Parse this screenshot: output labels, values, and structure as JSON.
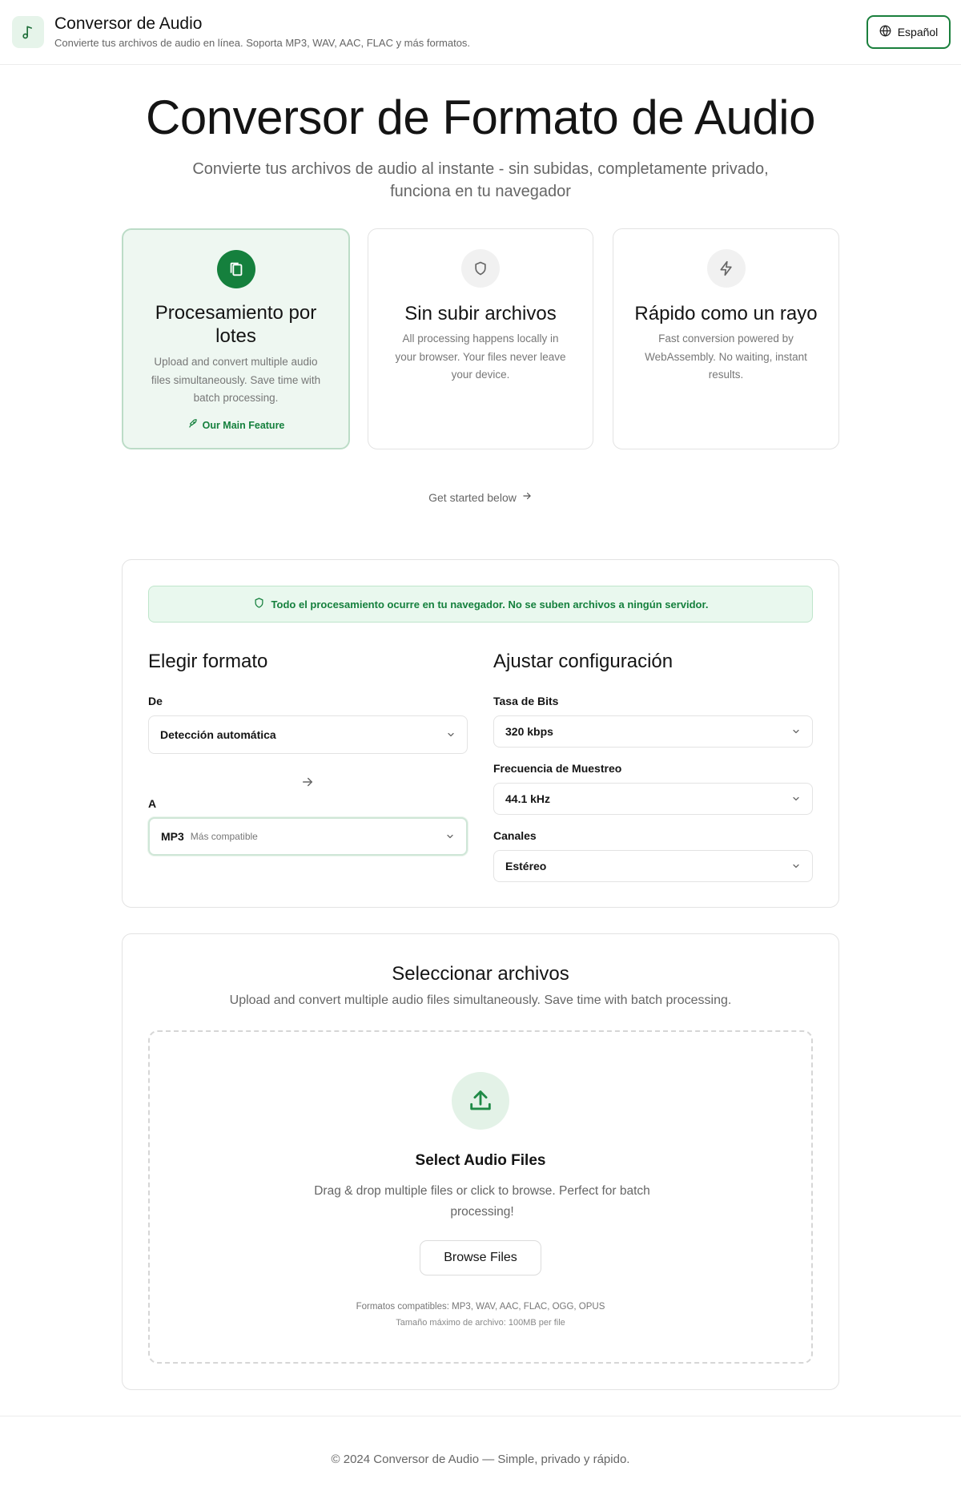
{
  "header": {
    "title": "Conversor de Audio",
    "subtitle": "Convierte tus archivos de audio en línea. Soporta MP3, WAV, AAC, FLAC y más formatos.",
    "language_button": "Español",
    "logo_icon": "music-note-icon",
    "language_icon": "globe-icon"
  },
  "hero": {
    "title": "Conversor de Formato de Audio",
    "subtitle": "Convierte tus archivos de audio al instante - sin subidas, completamente privado, funciona en tu navegador"
  },
  "features": [
    {
      "icon": "files-icon",
      "title": "Procesamiento por lotes",
      "description": "Upload and convert multiple audio files simultaneously. Save time with batch processing.",
      "tag": "Our Main Feature",
      "tag_icon": "rocket-icon",
      "highlighted": true
    },
    {
      "icon": "shield-icon",
      "title": "Sin subir archivos",
      "description": "All processing happens locally in your browser. Your files never leave your device."
    },
    {
      "icon": "lightning-icon",
      "title": "Rápido como un rayo",
      "description": "Fast conversion powered by WebAssembly. No waiting, instant results."
    }
  ],
  "get_started": "Get started below",
  "converter": {
    "notice": "Todo el procesamiento ocurre en tu navegador. No se suben archivos a ningún servidor.",
    "format": {
      "title": "Elegir formato",
      "from_label": "De",
      "from_value": "Detección automática",
      "to_label": "A",
      "to_value": "MP3",
      "to_hint": "Más compatible"
    },
    "settings": {
      "title": "Ajustar configuración",
      "bitrate_label": "Tasa de Bits",
      "bitrate_value": "320 kbps",
      "sample_rate_label": "Frecuencia de Muestreo",
      "sample_rate_value": "44.1 kHz",
      "channels_label": "Canales",
      "channels_value": "Estéreo"
    }
  },
  "upload": {
    "title": "Seleccionar archivos",
    "subtitle": "Upload and convert multiple audio files simultaneously. Save time with batch processing.",
    "drop_title": "Select Audio Files",
    "drop_desc": "Drag & drop multiple files or click to browse. Perfect for batch processing!",
    "browse_button": "Browse Files",
    "formats": "Formatos compatibles: MP3, WAV, AAC, FLAC, OGG, OPUS",
    "max_size": "Tamaño máximo de archivo: 100MB per file"
  },
  "footer": {
    "text": "© 2024 Conversor de Audio — Simple, privado y rápido."
  },
  "colors": {
    "accent": "#15803d",
    "accent_light": "#e9f8ee"
  }
}
